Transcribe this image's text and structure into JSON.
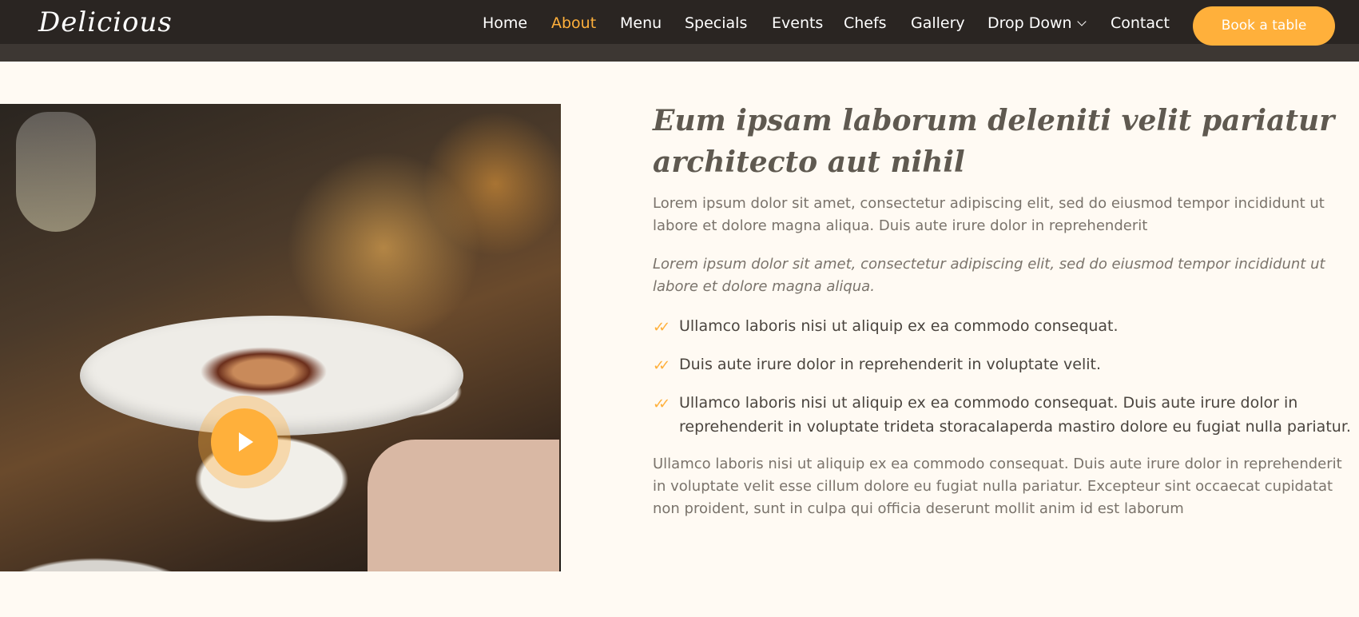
{
  "brand": {
    "logo": "Delicious"
  },
  "nav": {
    "items": [
      {
        "label": "Home"
      },
      {
        "label": "About"
      },
      {
        "label": "Menu"
      },
      {
        "label": "Specials"
      },
      {
        "label": "Events"
      },
      {
        "label": "Chefs"
      },
      {
        "label": "Gallery"
      },
      {
        "label": "Drop Down"
      },
      {
        "label": "Contact"
      }
    ],
    "active": "About",
    "book_button": "Book a table"
  },
  "about": {
    "headline_regular": "Eum ipsam laborum deleniti ",
    "headline_bold": "velit pariatur architecto aut nihil",
    "paragraph_1": "Lorem ipsum dolor sit amet, consectetur adipiscing elit, sed do eiusmod tempor incididunt ut labore et dolore magna aliqua. Duis aute irure dolor in reprehenderit",
    "paragraph_italic": "Lorem ipsum dolor sit amet, consectetur adipiscing elit, sed do eiusmod tempor incididunt ut labore et dolore magna aliqua.",
    "checklist": [
      "Ullamco laboris nisi ut aliquip ex ea commodo consequat.",
      "Duis aute irure dolor in reprehenderit in voluptate velit.",
      "Ullamco laboris nisi ut aliquip ex ea commodo consequat. Duis aute irure dolor in reprehenderit in voluptate trideta storacalaperda mastiro dolore eu fugiat nulla pariatur."
    ],
    "paragraph_2": "Ullamco laboris nisi ut aliquip ex ea commodo consequat. Duis aute irure dolor in reprehenderit in voluptate velit esse cillum dolore eu fugiat nulla pariatur. Excepteur sint occaecat cupidatat non proident, sunt in culpa qui officia deserunt mollit anim id est laborum"
  },
  "colors": {
    "accent": "#ffb03b",
    "header_bg": "#2a2522",
    "page_bg": "#fffaf3"
  },
  "icons": {
    "play": "play-icon",
    "check": "double-check-icon",
    "dropdown": "chevron-down-icon"
  }
}
